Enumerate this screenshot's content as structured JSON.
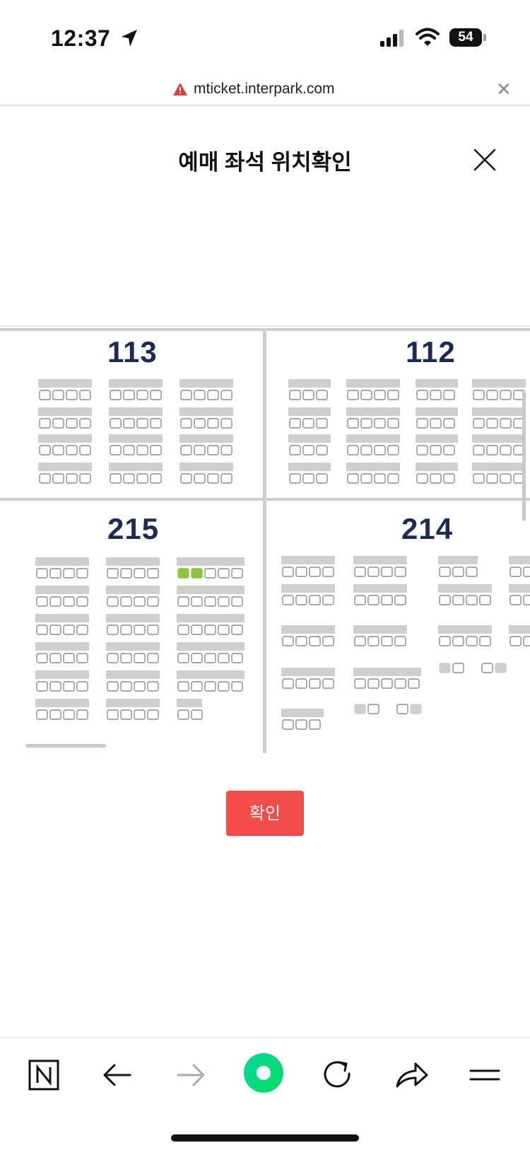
{
  "status_bar": {
    "time": "12:37",
    "battery": "54"
  },
  "url_bar": {
    "url": "mticket.interpark.com"
  },
  "modal": {
    "title": "예매 좌석 위치확인"
  },
  "seat_map": {
    "sections": [
      {
        "label": "113"
      },
      {
        "label": "112"
      },
      {
        "label": "215"
      },
      {
        "label": "214"
      }
    ],
    "highlighted_seats": 2,
    "highlight_color": "#8cc63f",
    "seat_color": "#8c8c8c",
    "row_bar_color": "#cfcfcf"
  },
  "confirm_button": {
    "label": "확인"
  },
  "colors": {
    "accent": "#f44b4b",
    "section_label": "#1d2a55"
  },
  "toolbar": {
    "icons": [
      "naver-icon",
      "back-arrow-icon",
      "forward-arrow-icon",
      "green-dot-icon",
      "refresh-icon",
      "share-icon",
      "menu-icon"
    ]
  }
}
